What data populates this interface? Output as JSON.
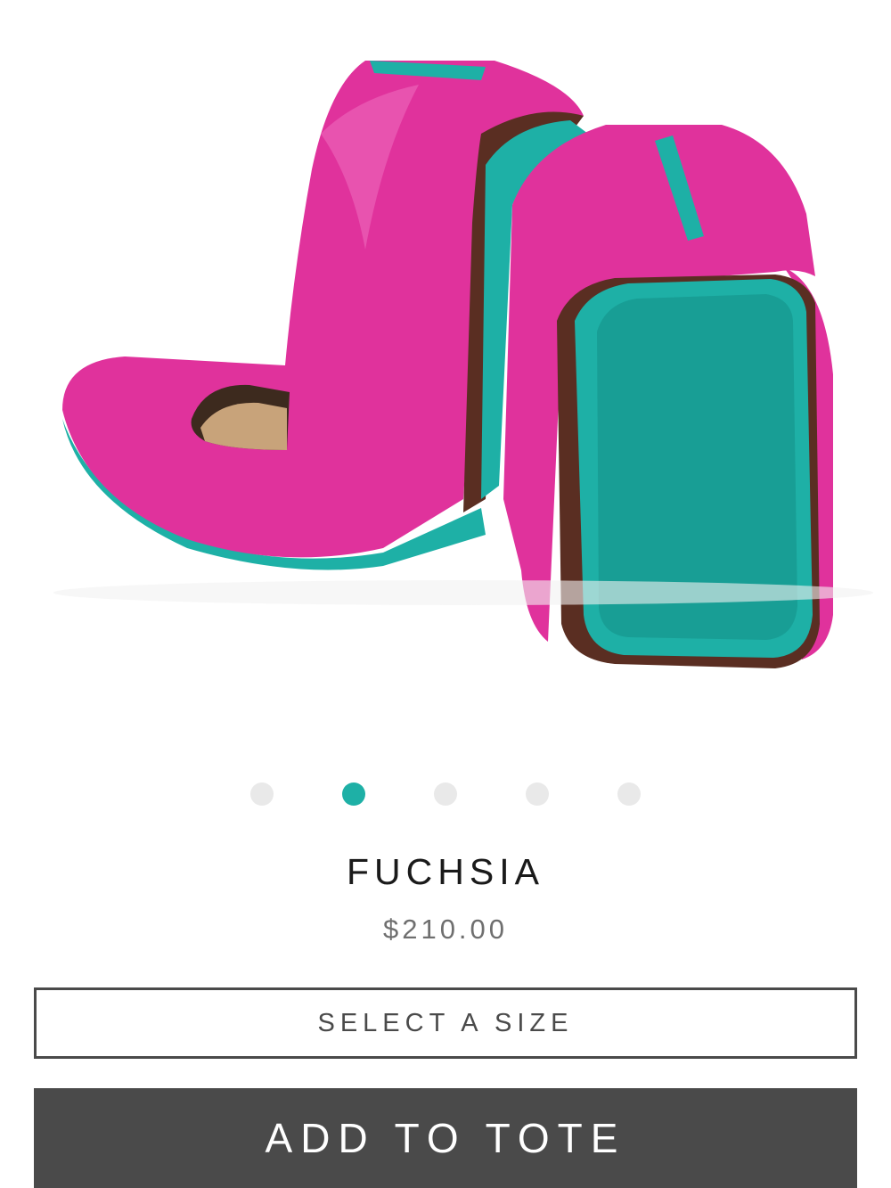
{
  "product": {
    "image_alt": "Fuchsia foldable ballet flats with teal soles",
    "name": "FUCHSIA",
    "price": "$210.00",
    "colors": {
      "leather": "#e0329c",
      "sole": "#1eb0a6",
      "lining": "#5a2e22"
    }
  },
  "carousel": {
    "dot_count": 5,
    "active_index": 1,
    "active_color": "#1eb0a6",
    "inactive_color": "#e9e9e9"
  },
  "actions": {
    "select_size_label": "SELECT A SIZE",
    "add_to_tote_label": "ADD TO TOTE"
  }
}
